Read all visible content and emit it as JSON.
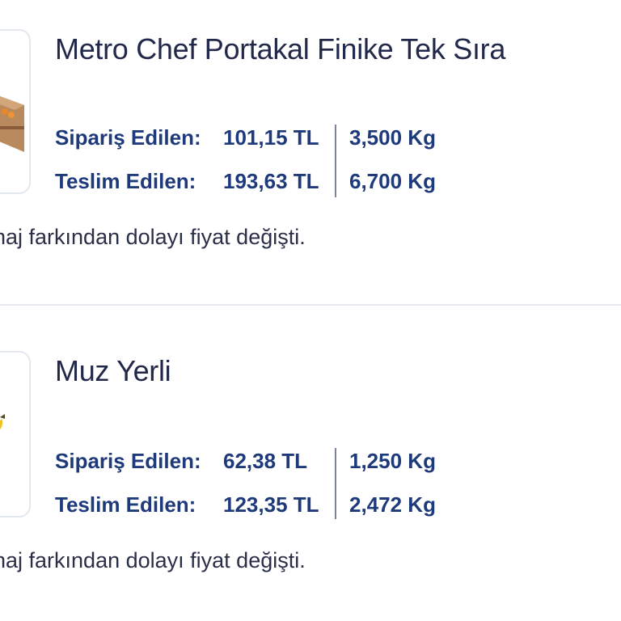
{
  "items": [
    {
      "title": "Metro Chef Portakal Finike Tek Sıra",
      "ordered_label": "Sipariş Edilen:",
      "ordered_price": "101,15 TL",
      "ordered_qty": "3,500 Kg",
      "delivered_label": "Teslim Edilen:",
      "delivered_price": "193,63 TL",
      "delivered_qty": "6,700 Kg",
      "note": "naj farkından dolayı fiyat değişti.",
      "image_icon": "orange-box-icon"
    },
    {
      "title": "Muz Yerli",
      "ordered_label": "Sipariş Edilen:",
      "ordered_price": "62,38 TL",
      "ordered_qty": "1,250 Kg",
      "delivered_label": "Teslim Edilen:",
      "delivered_price": "123,35 TL",
      "delivered_qty": "2,472 Kg",
      "note": "naj farkından dolayı fiyat değişti.",
      "image_icon": "banana-icon"
    }
  ],
  "colors": {
    "title": "#22284a",
    "label": "#1e3a7a",
    "note": "#2a2f47",
    "thumb_border": "#e3e7ee",
    "divider": "#e6e9ef"
  }
}
